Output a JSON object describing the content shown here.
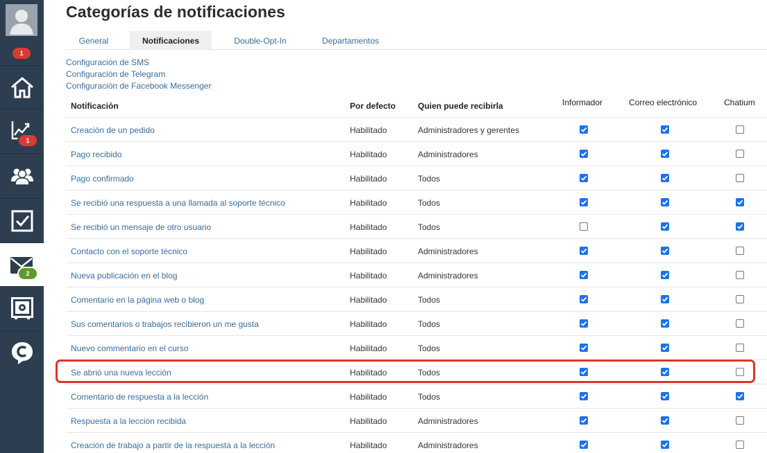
{
  "page": {
    "title": "Categorías de notificaciones"
  },
  "sidebar": {
    "badges": {
      "profile": "1",
      "analytics": "1",
      "messages": "2"
    },
    "items": [
      {
        "icon": "user-avatar-icon"
      },
      {
        "icon": "home-icon"
      },
      {
        "icon": "chart-icon"
      },
      {
        "icon": "users-icon"
      },
      {
        "icon": "tasks-checkbox-icon"
      },
      {
        "icon": "envelope-icon"
      },
      {
        "icon": "safe-icon"
      },
      {
        "icon": "chat-logo-icon"
      }
    ]
  },
  "tabs": [
    {
      "label": "General"
    },
    {
      "label": "Notificaciones",
      "active": true
    },
    {
      "label": "Double-Opt-In"
    },
    {
      "label": "Departamentos"
    }
  ],
  "config_links": [
    "Configuración de SMS",
    "Configuración de Telegram",
    "Configuración de Facebook Messenger"
  ],
  "table": {
    "headers": {
      "notification": "Notificación",
      "default": "Por defecto",
      "who": "Quien puede recibirla",
      "informer": "Informador",
      "email": "Correo electrónico",
      "chatium": "Chatium"
    },
    "rows": [
      {
        "name": "Creación de un pedido",
        "default": "Habilitado",
        "who": "Administradores y gerentes",
        "informer": true,
        "email": true,
        "chatium": false
      },
      {
        "name": "Pago recibido",
        "default": "Habilitado",
        "who": "Administradores",
        "informer": true,
        "email": true,
        "chatium": false
      },
      {
        "name": "Pago confirmado",
        "default": "Habilitado",
        "who": "Todos",
        "informer": true,
        "email": true,
        "chatium": false
      },
      {
        "name": "Se recibió una respuesta a una llamada al soporte técnico",
        "default": "Habilitado",
        "who": "Todos",
        "informer": true,
        "email": true,
        "chatium": true
      },
      {
        "name": "Se recibió un mensaje de otro usuario",
        "default": "Habilitado",
        "who": "Todos",
        "informer": false,
        "email": true,
        "chatium": true
      },
      {
        "name": "Contacto con el soporte técnico",
        "default": "Habilitado",
        "who": "Administradores",
        "informer": true,
        "email": true,
        "chatium": false
      },
      {
        "name": "Nueva publicación en el blog",
        "default": "Habilitado",
        "who": "Administradores",
        "informer": true,
        "email": true,
        "chatium": false
      },
      {
        "name": "Comentario en la página web o blog",
        "default": "Habilitado",
        "who": "Todos",
        "informer": true,
        "email": true,
        "chatium": false
      },
      {
        "name": "Sus comentarios o trabajos recibieron un me gusta",
        "default": "Habilitado",
        "who": "Todos",
        "informer": true,
        "email": true,
        "chatium": false
      },
      {
        "name": "Nuevo commentario en el curso",
        "default": "Habilitado",
        "who": "Todos",
        "informer": true,
        "email": true,
        "chatium": false
      },
      {
        "name": "Se abrió una nueva lección",
        "default": "Habilitado",
        "who": "Todos",
        "informer": true,
        "email": true,
        "chatium": false,
        "highlighted": true
      },
      {
        "name": "Comentario de respuesta a la lección",
        "default": "Habilitado",
        "who": "Todos",
        "informer": true,
        "email": true,
        "chatium": true
      },
      {
        "name": "Respuesta a la lección recibida",
        "default": "Habilitado",
        "who": "Administradores",
        "informer": true,
        "email": true,
        "chatium": false
      },
      {
        "name": "Creación de trabajo a partir de la respuesta a la lección",
        "default": "Habilitado",
        "who": "Administradores",
        "informer": true,
        "email": true,
        "chatium": false
      }
    ]
  },
  "colors": {
    "sidebar": "#2d3e50",
    "link": "#3a6d9c",
    "checkbox": "#1a73e8",
    "highlight": "#d9352f"
  }
}
